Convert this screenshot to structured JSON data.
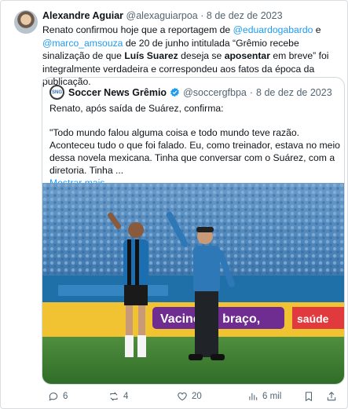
{
  "author": {
    "name": "Alexandre Aguiar",
    "handle": "@alexaguiarpoa",
    "separator": "·",
    "date": "8 de dez de 2023"
  },
  "tweet": {
    "part1": "Renato confirmou hoje que a reportagem de ",
    "mention1": "@eduardogabardo",
    "part2": " e ",
    "mention2": "@marco_amsouza",
    "part3": " de 20 de junho intitulada “Grêmio recebe sinalização de que ",
    "bold1": "Luís Suarez",
    "part4": " deseja se ",
    "bold2": "aposentar",
    "part5": " em breve” foi integralmente verdadeira e correspondeu aos fatos da época da publicação."
  },
  "quoted": {
    "avatar_text": "SNG",
    "name": "Soccer News Grêmio",
    "handle": "@soccergfbpa",
    "separator": "·",
    "date": "8 de dez de 2023",
    "line1": "Renato, após saída de Suárez, confirma:",
    "quote": "\"Todo mundo falou alguma coisa e todo mundo teve razão. Aconteceu tudo o que foi falado. Eu, como treinador, estava no meio dessa novela mexicana. Tinha que conversar com o Suárez, com a diretoria. Tinha ...",
    "show_more": "Mostrar mais",
    "photo_banner": "Vacine no braço,",
    "photo_banner2": "saúde"
  },
  "actions": {
    "replies": "6",
    "retweets": "4",
    "likes": "20",
    "views": "6 mil"
  },
  "colors": {
    "link": "#1d9bf0",
    "muted": "#536471",
    "border": "#cfd9de",
    "verified": "#1d9bf0"
  },
  "icons": [
    "reply-icon",
    "retweet-icon",
    "like-icon",
    "views-icon",
    "bookmark-icon",
    "share-icon",
    "verified-icon"
  ]
}
